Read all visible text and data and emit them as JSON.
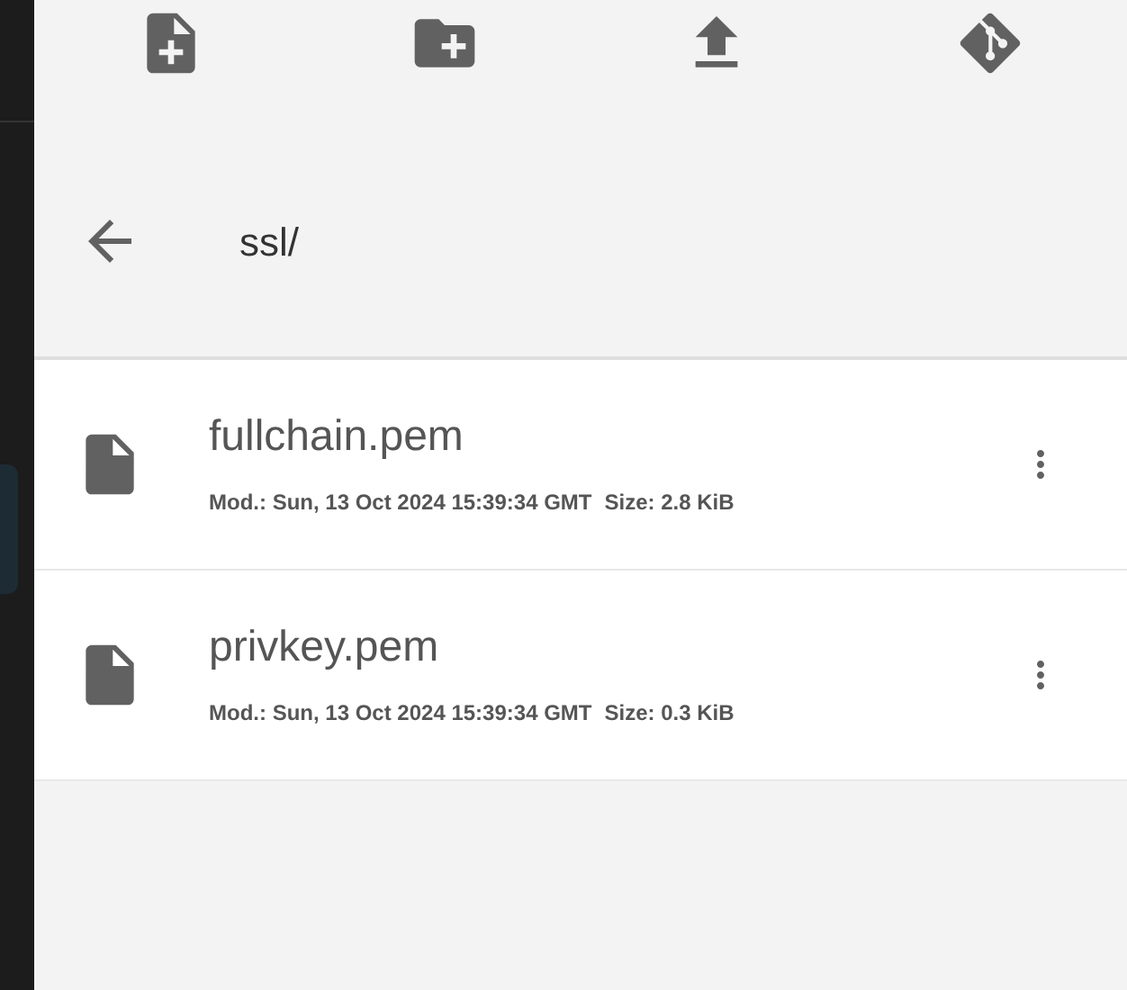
{
  "path": "ssl/",
  "files": [
    {
      "name": "fullchain.pem",
      "modified": "Mod.: Sun, 13 Oct 2024 15:39:34 GMT",
      "size": "Size: 2.8 KiB"
    },
    {
      "name": "privkey.pem",
      "modified": "Mod.: Sun, 13 Oct 2024 15:39:34 GMT",
      "size": "Size: 0.3 KiB"
    }
  ]
}
